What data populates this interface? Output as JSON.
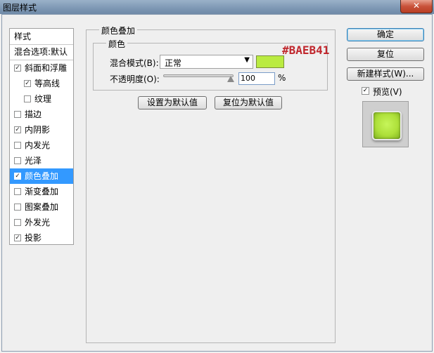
{
  "window": {
    "title": "图层样式",
    "close_glyph": "✕"
  },
  "styles_list": {
    "header": "样式",
    "blend_options": "混合选项:默认",
    "items": [
      {
        "label": "斜面和浮雕",
        "checked": true
      },
      {
        "label": "等高线",
        "checked": true,
        "indent": true
      },
      {
        "label": "纹理",
        "checked": false,
        "indent": true
      },
      {
        "label": "描边",
        "checked": false
      },
      {
        "label": "内阴影",
        "checked": true
      },
      {
        "label": "内发光",
        "checked": false
      },
      {
        "label": "光泽",
        "checked": false
      },
      {
        "label": "颜色叠加",
        "checked": true,
        "selected": true
      },
      {
        "label": "渐变叠加",
        "checked": false
      },
      {
        "label": "图案叠加",
        "checked": false
      },
      {
        "label": "外发光",
        "checked": false
      },
      {
        "label": "投影",
        "checked": true
      }
    ]
  },
  "overlay_panel": {
    "title": "颜色叠加",
    "subtitle": "颜色",
    "blend_mode_label": "混合模式(B):",
    "blend_mode_value": "正常",
    "color": "#baeb41",
    "color_annotation": "#BAEB41",
    "opacity_label": "不透明度(O):",
    "opacity_value": "100",
    "opacity_unit": "%",
    "opacity_percent": 100,
    "set_default_label": "设置为默认值",
    "reset_default_label": "复位为默认值"
  },
  "right_buttons": {
    "ok_label": "确定",
    "reset_label": "复位",
    "new_style_label": "新建样式(W)...",
    "preview_label": "预览(V)",
    "preview_checked": true
  }
}
